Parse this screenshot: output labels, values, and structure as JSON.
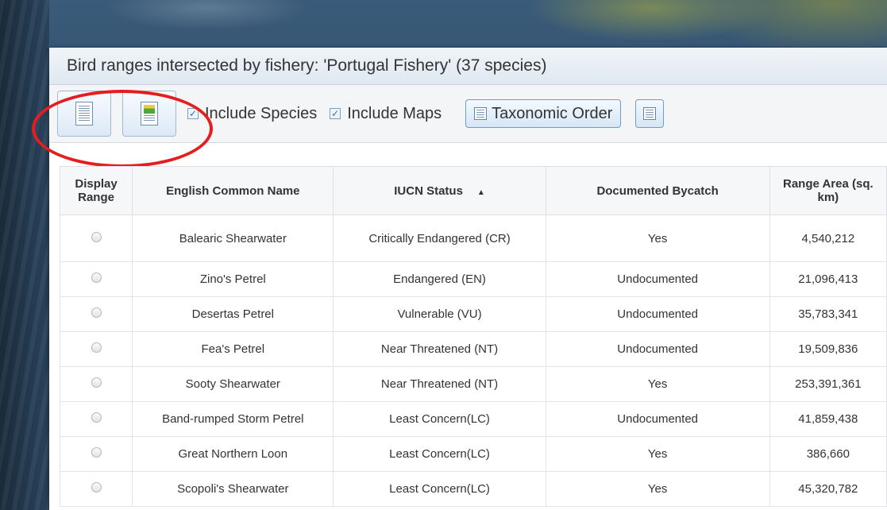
{
  "panel": {
    "title": "Bird ranges intersected by fishery: 'Portugal Fishery' (37 species)"
  },
  "toolbar": {
    "report_icon": "document-icon",
    "map_report_icon": "map-document-icon",
    "include_species_label": "Include Species",
    "include_maps_label": "Include Maps",
    "taxonomic_order_label": "Taxonomic Order",
    "settings_icon": "settings-icon",
    "include_species_checked": true,
    "include_maps_checked": true
  },
  "table": {
    "headers": {
      "display_range": "Display Range",
      "common_name": "English Common Name",
      "iucn_status": "IUCN Status",
      "bycatch": "Documented Bycatch",
      "range_area": "Range Area (sq. km)"
    },
    "sort_indicator": "▲",
    "rows": [
      {
        "name": "Balearic Shearwater",
        "status": "Critically Endangered (CR)",
        "bycatch": "Yes",
        "area": "4,540,212"
      },
      {
        "name": "Zino's Petrel",
        "status": "Endangered (EN)",
        "bycatch": "Undocumented",
        "area": "21,096,413"
      },
      {
        "name": "Desertas Petrel",
        "status": "Vulnerable (VU)",
        "bycatch": "Undocumented",
        "area": "35,783,341"
      },
      {
        "name": "Fea's Petrel",
        "status": "Near Threatened (NT)",
        "bycatch": "Undocumented",
        "area": "19,509,836"
      },
      {
        "name": "Sooty Shearwater",
        "status": "Near Threatened (NT)",
        "bycatch": "Yes",
        "area": "253,391,361"
      },
      {
        "name": "Band-rumped Storm Petrel",
        "status": "Least Concern(LC)",
        "bycatch": "Undocumented",
        "area": "41,859,438"
      },
      {
        "name": "Great Northern Loon",
        "status": "Least Concern(LC)",
        "bycatch": "Yes",
        "area": "386,660"
      },
      {
        "name": "Scopoli's Shearwater",
        "status": "Least Concern(LC)",
        "bycatch": "Yes",
        "area": "45,320,782"
      }
    ]
  },
  "colors": {
    "highlight_circle": "#e41e1e",
    "button_border": "#6f9cc9"
  }
}
